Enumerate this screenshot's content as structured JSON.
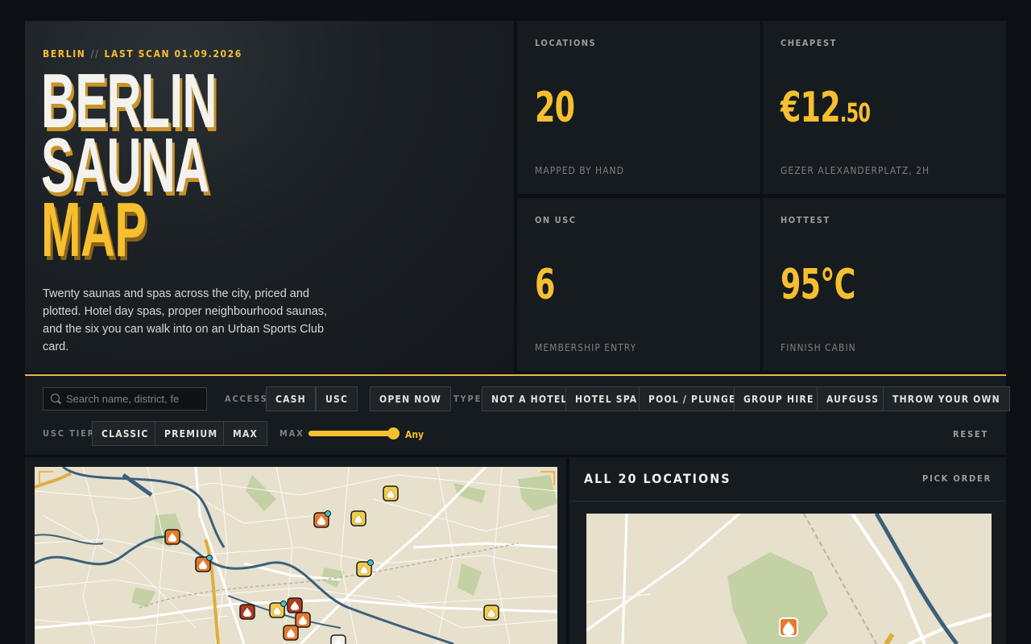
{
  "hero": {
    "city": "BERLIN",
    "separator": "//",
    "last_scan": "LAST SCAN 01.09.2026",
    "title_lines": [
      "BERLIN",
      "SAUNA",
      "MAP"
    ],
    "intro": "Twenty saunas and spas across the city, priced and plotted. Hotel day spas, proper neighbourhood saunas, and the six you can walk into on an Urban Sports Club card."
  },
  "stats": {
    "locations": {
      "label": "LOCATIONS",
      "value": "20",
      "sub": "MAPPED BY HAND"
    },
    "cheapest": {
      "label": "CHEAPEST",
      "value_main": "€12",
      "value_cents": ".50",
      "sub": "GEZER ALEXANDERPLATZ, 2H"
    },
    "usc": {
      "label": "ON USC",
      "value": "6",
      "sub": "MEMBERSHIP ENTRY"
    },
    "hottest": {
      "label": "HOTTEST",
      "value": "95°C",
      "sub": "FINNISH CABIN"
    }
  },
  "filters": {
    "search_placeholder": "Search name, district, fe",
    "access_label": "ACCESS",
    "access": [
      "CASH",
      "USC"
    ],
    "open_now": "OPEN NOW",
    "type_label": "TYPE",
    "types": [
      "NOT A HOTEL",
      "HOTEL SPA",
      "POOL / PLUNGE",
      "GROUP HIRE",
      "AUFGUSS",
      "THROW YOUR OWN"
    ],
    "tier_label": "USC TIER",
    "tiers": [
      "CLASSIC",
      "PREMIUM",
      "MAX"
    ],
    "max_label": "MAX",
    "max_value": "Any",
    "max_level": 1.0,
    "reset": "RESET"
  },
  "list": {
    "title": "ALL 20 LOCATIONS",
    "sort": "PICK ORDER"
  },
  "colors": {
    "accent": "#f6bf30",
    "pin_orange": "#e8792b",
    "pin_red": "#b3391f",
    "pin_yellow": "#f3cc4a",
    "usc_dot": "#3fc3d6",
    "water": "#3d6079",
    "park": "#c3d1a4"
  },
  "icons": [
    "search-icon",
    "flame-icon"
  ]
}
